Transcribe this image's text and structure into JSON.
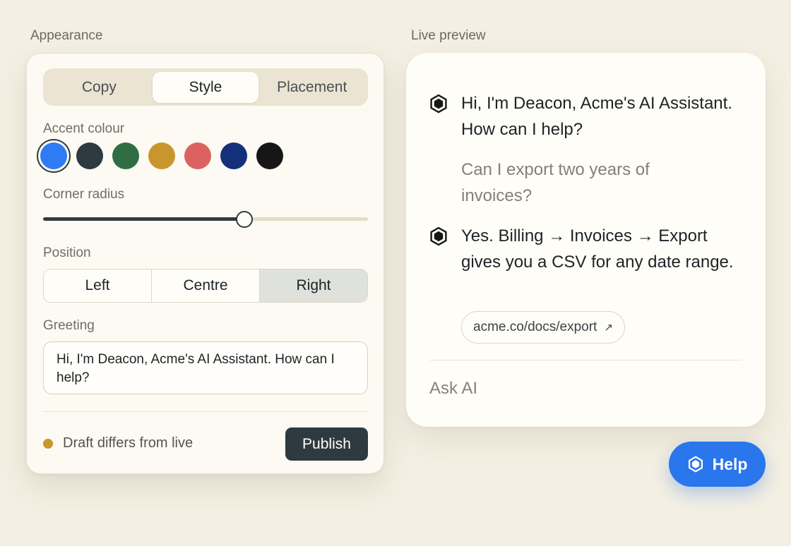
{
  "labels": {
    "appearance": "Appearance",
    "live_preview": "Live preview"
  },
  "tabs": [
    {
      "label": "Copy",
      "active": false
    },
    {
      "label": "Style",
      "active": true
    },
    {
      "label": "Placement",
      "active": false
    }
  ],
  "accent": {
    "label": "Accent colour",
    "selected_index": 0,
    "swatches": [
      "#2f7bf5",
      "#2d3b40",
      "#2f6e45",
      "#c9962e",
      "#dc6262",
      "#15307a",
      "#161616"
    ]
  },
  "corner_radius": {
    "label": "Corner radius",
    "value_fraction": 0.62
  },
  "position": {
    "label": "Position",
    "options": [
      "Left",
      "Centre",
      "Right"
    ],
    "selected_index": 2
  },
  "greeting": {
    "label": "Greeting",
    "value": "Hi, I'm Deacon, Acme's AI Assistant. How can I help?"
  },
  "status": {
    "text": "Draft differs from live",
    "dot_color": "#c9962e"
  },
  "publish_label": "Publish",
  "preview": {
    "messages": [
      {
        "role": "bot",
        "text": "Hi, I'm Deacon, Acme's AI Assistant. How can I help?"
      },
      {
        "role": "user",
        "text": "Can I export two years of invoices?"
      },
      {
        "role": "bot",
        "text": "Yes. Billing → Invoices → Export gives you a CSV for any date range."
      }
    ],
    "link_chip": "acme.co/docs/export",
    "link_arrow": "↗",
    "input_placeholder": "Ask AI"
  },
  "help_button": {
    "label": "Help",
    "color": "#2a76ec"
  }
}
